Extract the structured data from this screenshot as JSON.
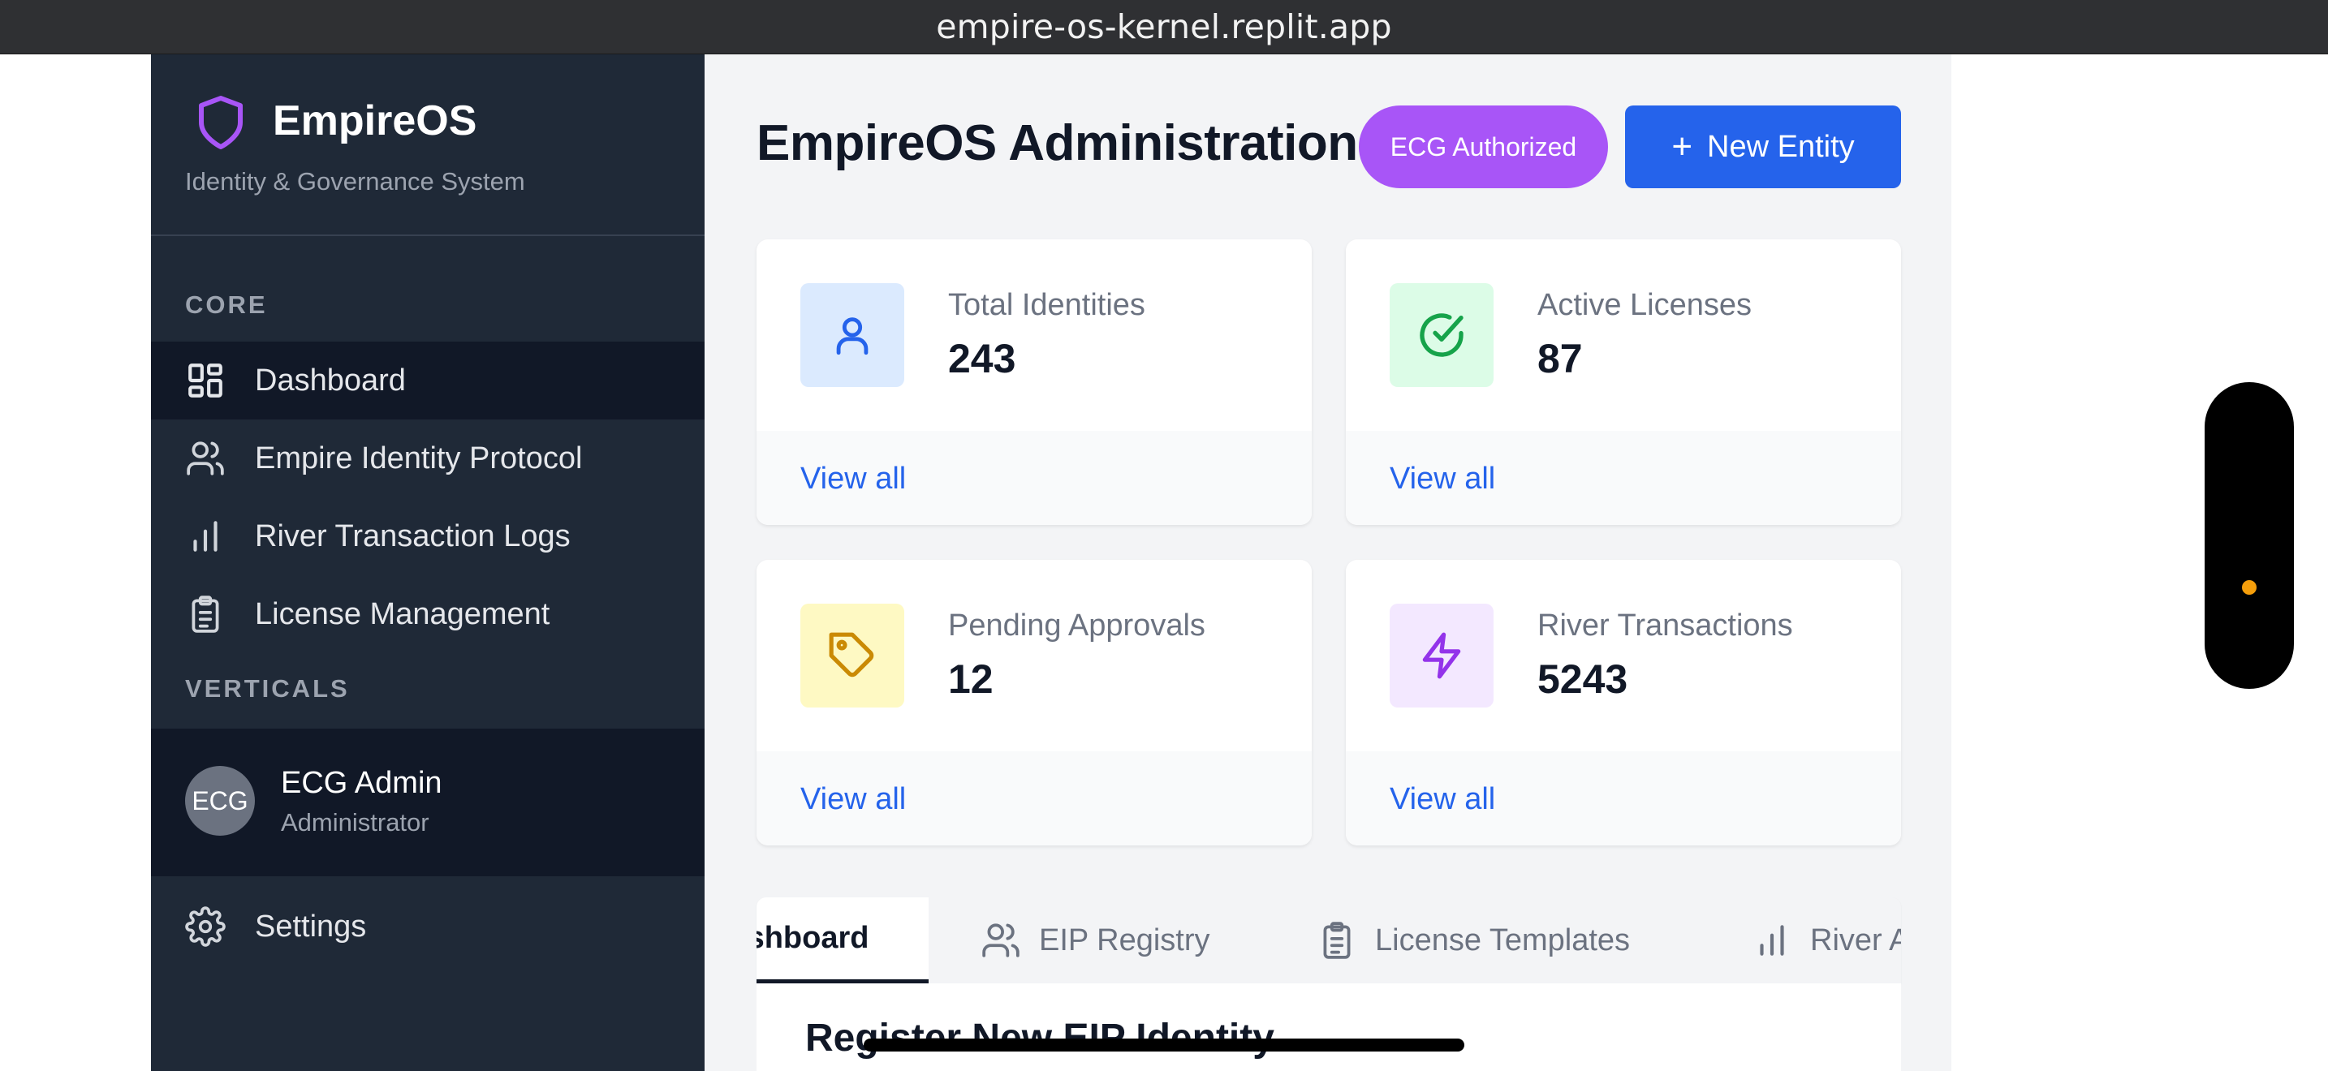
{
  "browser": {
    "url": "empire-os-kernel.replit.app"
  },
  "sidebar": {
    "brand_name": "EmpireOS",
    "brand_subtitle": "Identity & Governance System",
    "sections": {
      "core": "CORE",
      "verticals": "VERTICALS"
    },
    "items": [
      {
        "label": "Dashboard",
        "icon": "dashboard-icon",
        "active": true
      },
      {
        "label": "Empire Identity Protocol",
        "icon": "users-icon"
      },
      {
        "label": "River Transaction Logs",
        "icon": "bar-chart-icon"
      },
      {
        "label": "License Management",
        "icon": "clipboard-icon"
      }
    ],
    "user": {
      "initials": "ECG",
      "name": "ECG Admin",
      "role": "Administrator"
    },
    "settings_label": "Settings"
  },
  "header": {
    "title": "EmpireOS Administration",
    "badge": "ECG Authorized",
    "new_button_label": "New Entity"
  },
  "stats": [
    {
      "label": "Total Identities",
      "value": "243",
      "link": "View all",
      "icon": "user-icon",
      "color": "#2563eb",
      "bg": "#dbeafe"
    },
    {
      "label": "Active Licenses",
      "value": "87",
      "link": "View all",
      "icon": "check-circle-icon",
      "color": "#16a34a",
      "bg": "#dcfce7"
    },
    {
      "label": "Pending Approvals",
      "value": "12",
      "link": "View all",
      "icon": "tag-icon",
      "color": "#ca8a04",
      "bg": "#fef9c3"
    },
    {
      "label": "River Transactions",
      "value": "5243",
      "link": "View all",
      "icon": "zap-icon",
      "color": "#9333ea",
      "bg": "#f3e8ff"
    }
  ],
  "tabs": [
    {
      "label": "Dashboard",
      "active": true
    },
    {
      "label": "EIP Registry",
      "icon": "users-icon"
    },
    {
      "label": "License Templates",
      "icon": "clipboard-icon"
    },
    {
      "label": "River Analytics",
      "icon": "bar-chart-icon"
    }
  ],
  "panel": {
    "heading": "Register New EIP Identity"
  }
}
